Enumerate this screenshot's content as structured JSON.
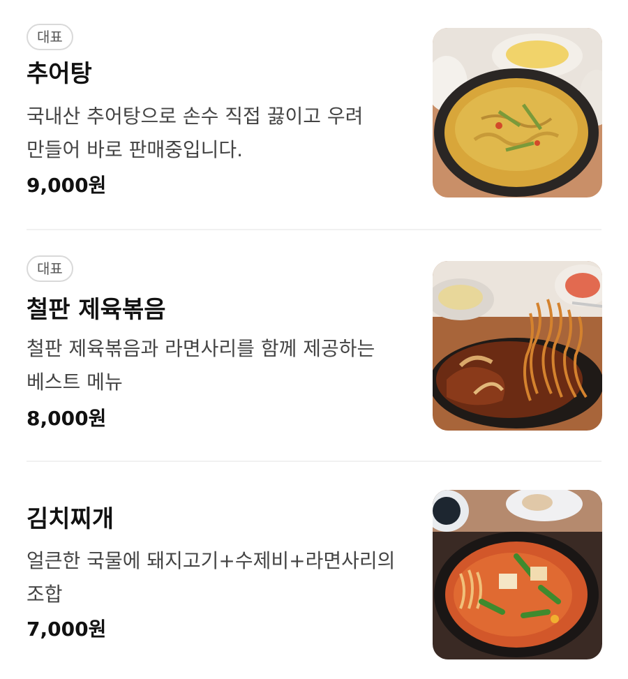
{
  "menu_items": [
    {
      "badge": "대표",
      "name": "추어탕",
      "description": "국내산 추어탕으로 손수 직접 끓이고 우려 만들어 바로 판매중입니다.",
      "price": "9,000원"
    },
    {
      "badge": "대표",
      "name": "철판 제육볶음",
      "description": "철판 제육볶음과 라면사리를 함께 제공하는 베스트 메뉴",
      "price": "8,000원"
    },
    {
      "name": "김치찌개",
      "description": "얼큰한 국물에 돼지고기+수제비+라면사리의 조합",
      "price": "7,000원"
    }
  ],
  "colors": {
    "badge_border": "#d9d9d9",
    "divider": "#f1f1f1",
    "text_primary": "#111111",
    "text_secondary": "#444444"
  }
}
